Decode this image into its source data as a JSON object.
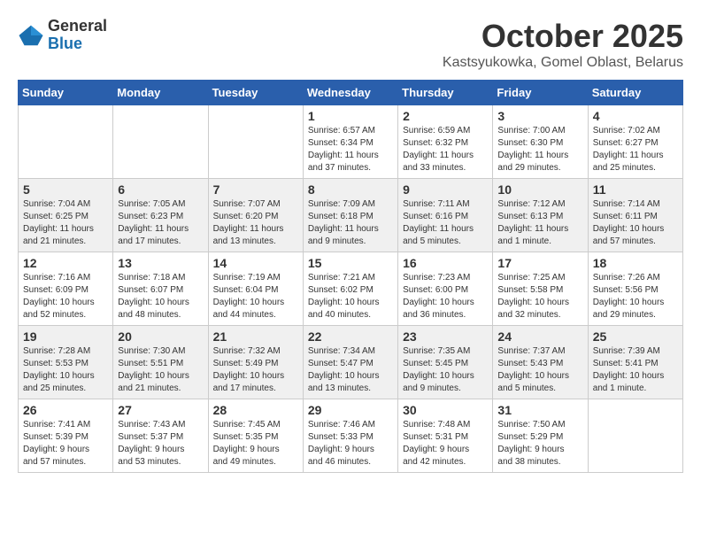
{
  "logo": {
    "general": "General",
    "blue": "Blue"
  },
  "title": "October 2025",
  "location": "Kastsyukowka, Gomel Oblast, Belarus",
  "days_header": [
    "Sunday",
    "Monday",
    "Tuesday",
    "Wednesday",
    "Thursday",
    "Friday",
    "Saturday"
  ],
  "weeks": [
    [
      {
        "day": "",
        "info": ""
      },
      {
        "day": "",
        "info": ""
      },
      {
        "day": "",
        "info": ""
      },
      {
        "day": "1",
        "info": "Sunrise: 6:57 AM\nSunset: 6:34 PM\nDaylight: 11 hours\nand 37 minutes."
      },
      {
        "day": "2",
        "info": "Sunrise: 6:59 AM\nSunset: 6:32 PM\nDaylight: 11 hours\nand 33 minutes."
      },
      {
        "day": "3",
        "info": "Sunrise: 7:00 AM\nSunset: 6:30 PM\nDaylight: 11 hours\nand 29 minutes."
      },
      {
        "day": "4",
        "info": "Sunrise: 7:02 AM\nSunset: 6:27 PM\nDaylight: 11 hours\nand 25 minutes."
      }
    ],
    [
      {
        "day": "5",
        "info": "Sunrise: 7:04 AM\nSunset: 6:25 PM\nDaylight: 11 hours\nand 21 minutes."
      },
      {
        "day": "6",
        "info": "Sunrise: 7:05 AM\nSunset: 6:23 PM\nDaylight: 11 hours\nand 17 minutes."
      },
      {
        "day": "7",
        "info": "Sunrise: 7:07 AM\nSunset: 6:20 PM\nDaylight: 11 hours\nand 13 minutes."
      },
      {
        "day": "8",
        "info": "Sunrise: 7:09 AM\nSunset: 6:18 PM\nDaylight: 11 hours\nand 9 minutes."
      },
      {
        "day": "9",
        "info": "Sunrise: 7:11 AM\nSunset: 6:16 PM\nDaylight: 11 hours\nand 5 minutes."
      },
      {
        "day": "10",
        "info": "Sunrise: 7:12 AM\nSunset: 6:13 PM\nDaylight: 11 hours\nand 1 minute."
      },
      {
        "day": "11",
        "info": "Sunrise: 7:14 AM\nSunset: 6:11 PM\nDaylight: 10 hours\nand 57 minutes."
      }
    ],
    [
      {
        "day": "12",
        "info": "Sunrise: 7:16 AM\nSunset: 6:09 PM\nDaylight: 10 hours\nand 52 minutes."
      },
      {
        "day": "13",
        "info": "Sunrise: 7:18 AM\nSunset: 6:07 PM\nDaylight: 10 hours\nand 48 minutes."
      },
      {
        "day": "14",
        "info": "Sunrise: 7:19 AM\nSunset: 6:04 PM\nDaylight: 10 hours\nand 44 minutes."
      },
      {
        "day": "15",
        "info": "Sunrise: 7:21 AM\nSunset: 6:02 PM\nDaylight: 10 hours\nand 40 minutes."
      },
      {
        "day": "16",
        "info": "Sunrise: 7:23 AM\nSunset: 6:00 PM\nDaylight: 10 hours\nand 36 minutes."
      },
      {
        "day": "17",
        "info": "Sunrise: 7:25 AM\nSunset: 5:58 PM\nDaylight: 10 hours\nand 32 minutes."
      },
      {
        "day": "18",
        "info": "Sunrise: 7:26 AM\nSunset: 5:56 PM\nDaylight: 10 hours\nand 29 minutes."
      }
    ],
    [
      {
        "day": "19",
        "info": "Sunrise: 7:28 AM\nSunset: 5:53 PM\nDaylight: 10 hours\nand 25 minutes."
      },
      {
        "day": "20",
        "info": "Sunrise: 7:30 AM\nSunset: 5:51 PM\nDaylight: 10 hours\nand 21 minutes."
      },
      {
        "day": "21",
        "info": "Sunrise: 7:32 AM\nSunset: 5:49 PM\nDaylight: 10 hours\nand 17 minutes."
      },
      {
        "day": "22",
        "info": "Sunrise: 7:34 AM\nSunset: 5:47 PM\nDaylight: 10 hours\nand 13 minutes."
      },
      {
        "day": "23",
        "info": "Sunrise: 7:35 AM\nSunset: 5:45 PM\nDaylight: 10 hours\nand 9 minutes."
      },
      {
        "day": "24",
        "info": "Sunrise: 7:37 AM\nSunset: 5:43 PM\nDaylight: 10 hours\nand 5 minutes."
      },
      {
        "day": "25",
        "info": "Sunrise: 7:39 AM\nSunset: 5:41 PM\nDaylight: 10 hours\nand 1 minute."
      }
    ],
    [
      {
        "day": "26",
        "info": "Sunrise: 7:41 AM\nSunset: 5:39 PM\nDaylight: 9 hours\nand 57 minutes."
      },
      {
        "day": "27",
        "info": "Sunrise: 7:43 AM\nSunset: 5:37 PM\nDaylight: 9 hours\nand 53 minutes."
      },
      {
        "day": "28",
        "info": "Sunrise: 7:45 AM\nSunset: 5:35 PM\nDaylight: 9 hours\nand 49 minutes."
      },
      {
        "day": "29",
        "info": "Sunrise: 7:46 AM\nSunset: 5:33 PM\nDaylight: 9 hours\nand 46 minutes."
      },
      {
        "day": "30",
        "info": "Sunrise: 7:48 AM\nSunset: 5:31 PM\nDaylight: 9 hours\nand 42 minutes."
      },
      {
        "day": "31",
        "info": "Sunrise: 7:50 AM\nSunset: 5:29 PM\nDaylight: 9 hours\nand 38 minutes."
      },
      {
        "day": "",
        "info": ""
      }
    ]
  ]
}
